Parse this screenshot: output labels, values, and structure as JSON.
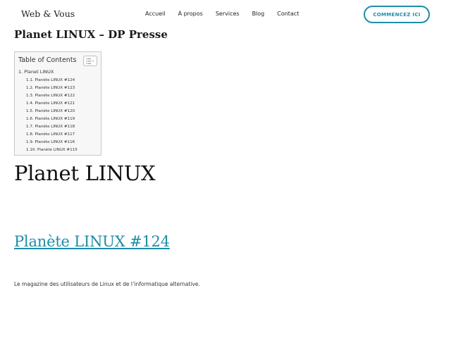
{
  "header": {
    "site_title": "Web & Vous",
    "nav": [
      "Accueil",
      "À propos",
      "Services",
      "Blog",
      "Contact"
    ],
    "cta_label": "COMMENCEZ ICI"
  },
  "page_title": "Planet LINUX – DP Presse",
  "toc": {
    "title": "Table of Contents",
    "toggle_icon": "list-toggle-icon",
    "top_item": "1. Planet LINUX",
    "items": [
      "1.1. Planète LINUX #124",
      "1.2. Planète LINUX #123",
      "1.3. Planète LINUX #122",
      "1.4. Planète LINUX #121",
      "1.5. Planète LINUX #120",
      "1.6. Planète LINUX #119",
      "1.7. Planète LINUX #118",
      "1.8. Planète LINUX #117",
      "1.9. Planète LINUX #116",
      "1.10. Planète LINUX #115"
    ]
  },
  "content": {
    "heading": "Planet LINUX",
    "subheading": "Planète LINUX #124",
    "paragraph": "Le magazine des utilisateurs de Linux et de l’informatique alternative."
  },
  "colors": {
    "accent": "#1e8da8",
    "text": "#222222",
    "toc_background": "#f7f7f7"
  }
}
